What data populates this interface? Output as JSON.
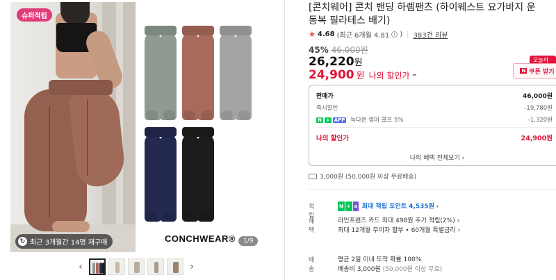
{
  "gallery": {
    "badge_top": "슈퍼적립",
    "badge_bottom": "최근 3개월간 14명 재구매",
    "brand": "CONCHWEAR®",
    "counter": "1/9",
    "prev_icon": "‹",
    "next_icon": "›",
    "thumbnails": 5,
    "pants_colors": [
      "#8e9a92",
      "#a86a5b",
      "#a4a4a2",
      "#23294f",
      "#1c1c1c"
    ]
  },
  "product": {
    "title": "[콘치웨어] 콘치 밴딩 하렘팬츠 (하이웨스트 요가바지 운동복 필라테스 배기)",
    "rating": {
      "score": "4.68",
      "recent": "(최근 6개월 4.81",
      "recent_close": ")",
      "reviews": "383건 리뷰"
    },
    "discount_pct": "45%",
    "original_price": "46,000원",
    "sale_price": "26,220",
    "won": "원",
    "my_price": "24,900",
    "my_price_label": "나의 할인가",
    "today_tag": "오늘까지",
    "coupon_label": "쿠폰 받기"
  },
  "breakdown": {
    "sale_label": "판매가",
    "sale_value": "46,000원",
    "instant_label": "즉시할인",
    "instant_value": "-19,780원",
    "app_label": "늑다운 썸머 클프 5%",
    "app_value": "-1,320원",
    "my_label": "나의 할인가",
    "my_value": "24,900원",
    "all_benefits": "나의 혜택 전체보기"
  },
  "shipping": {
    "text": "3,000원 (50,000원 이상 무료배송)"
  },
  "sections": {
    "points_label": "적립",
    "points_text": "최대 적립 포인트 4,535원",
    "benefit_label": "혜택",
    "benefit_line1": "라인프렌즈 카드 최대 498원 추가 적립(2%)",
    "benefit_line2": "최대 12개월 무이자 할부 • 60개월 특별금리",
    "delivery_label": "배송",
    "delivery_line1": "평균 2일 이내 도착 확률 100%",
    "delivery_line2": "배송비 3,000원",
    "delivery_line2_sub": "(50,000원 이상 무료)"
  }
}
